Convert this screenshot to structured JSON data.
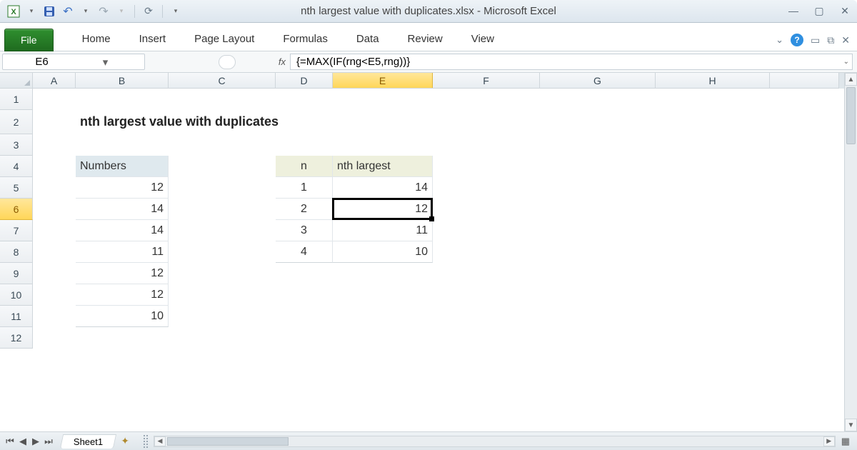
{
  "window": {
    "title": "nth largest value with duplicates.xlsx  -  Microsoft Excel"
  },
  "ribbon": {
    "file": "File",
    "tabs": [
      "Home",
      "Insert",
      "Page Layout",
      "Formulas",
      "Data",
      "Review",
      "View"
    ]
  },
  "namebox": "E6",
  "formula": "{=MAX(IF(rng<E5,rng))}",
  "columns": [
    "A",
    "B",
    "C",
    "D",
    "E",
    "F",
    "G",
    "H"
  ],
  "rows": [
    "1",
    "2",
    "3",
    "4",
    "5",
    "6",
    "7",
    "8",
    "9",
    "10",
    "11",
    "12"
  ],
  "active": {
    "col": "E",
    "row": "6"
  },
  "content": {
    "title": "nth largest value with duplicates",
    "numbers_header": "Numbers",
    "numbers": [
      "12",
      "14",
      "14",
      "11",
      "12",
      "12",
      "10"
    ],
    "n_header": "n",
    "nth_header": "nth largest",
    "n_vals": [
      "1",
      "2",
      "3",
      "4"
    ],
    "nth_vals": [
      "14",
      "12",
      "11",
      "10"
    ]
  },
  "sheet": {
    "name": "Sheet1"
  }
}
